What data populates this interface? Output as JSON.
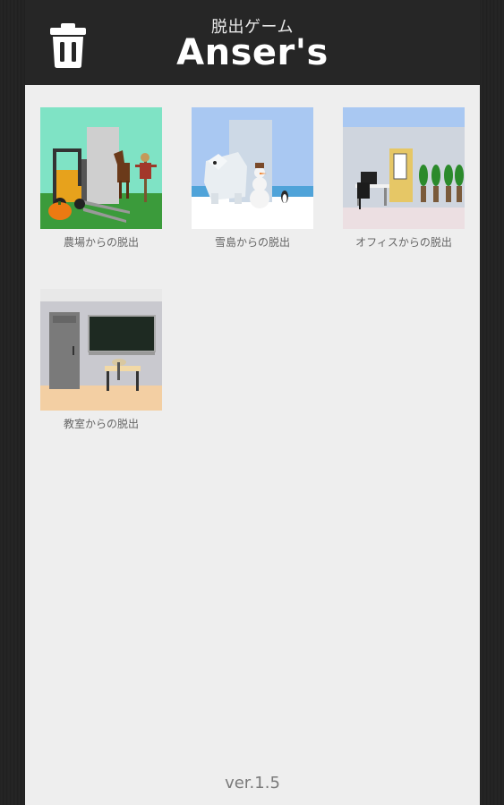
{
  "header": {
    "subtitle": "脱出ゲーム",
    "title": "Anser's",
    "delete_icon": "trash-icon"
  },
  "games": [
    {
      "label": "農場からの脱出"
    },
    {
      "label": "雪島からの脱出"
    },
    {
      "label": "オフィスからの脱出"
    },
    {
      "label": "教室からの脱出"
    }
  ],
  "footer": {
    "version": "ver.1.5"
  },
  "colors": {
    "header_bg": "#262626",
    "content_bg": "#eeeeee",
    "title_text": "#ffffff",
    "label_text": "#666666"
  }
}
